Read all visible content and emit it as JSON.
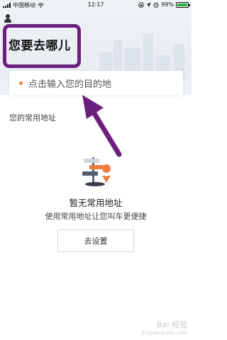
{
  "status_bar": {
    "carrier": "中国移动",
    "time": "12:17",
    "battery": "99%",
    "battery_level": 0.99
  },
  "header": {
    "title": "您要去哪儿",
    "user_icon": "user-icon"
  },
  "search": {
    "placeholder": "点击输入您的目的地",
    "dot_color": "#f07c3c"
  },
  "frequent": {
    "section_label": "您的常用地址",
    "empty_title": "暂无常用地址",
    "empty_subtitle": "使用常用地址让您叫车更便捷",
    "button_label": "去设置"
  },
  "annotations": {
    "highlight_color": "#6d1f7d",
    "arrow_color": "#6d1f7d"
  },
  "watermark": {
    "text": "Bai 经验",
    "sub": "jingyan.baidu.com"
  }
}
